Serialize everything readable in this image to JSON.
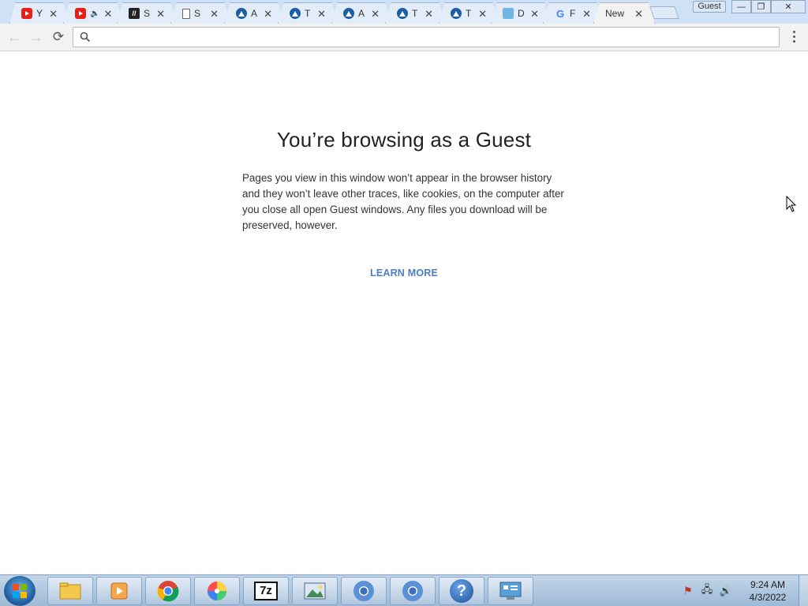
{
  "browser": {
    "tabs": [
      {
        "label": "Y",
        "favicon": "youtube-icon",
        "active": false
      },
      {
        "label": "",
        "favicon": "youtube-icon",
        "audio": "speaker-icon",
        "active": false
      },
      {
        "label": "S",
        "favicon": "dark-app-icon",
        "active": false
      },
      {
        "label": "S",
        "favicon": "document-icon",
        "active": false
      },
      {
        "label": "A",
        "favicon": "blue-triangle-icon",
        "active": false
      },
      {
        "label": "T",
        "favicon": "blue-triangle-icon",
        "active": false
      },
      {
        "label": "A",
        "favicon": "blue-triangle-icon",
        "active": false
      },
      {
        "label": "T",
        "favicon": "blue-triangle-icon",
        "active": false
      },
      {
        "label": "T",
        "favicon": "blue-triangle-icon",
        "active": false
      },
      {
        "label": "D",
        "favicon": "map-icon",
        "active": false
      },
      {
        "label": "F",
        "favicon": "google-icon",
        "active": false
      },
      {
        "label": "New",
        "favicon": "",
        "active": true
      }
    ],
    "tab_close_glyph": "✕",
    "profile_badge": "Guest",
    "window_controls": {
      "minimize": "—",
      "restore": "❐",
      "close": "✕"
    },
    "omnibox": {
      "value": "",
      "placeholder": ""
    }
  },
  "page": {
    "heading": "You’re browsing as a Guest",
    "body": "Pages you view in this window won’t appear in the browser history and they won’t leave other traces, like cookies, on the computer after you close all open Guest windows. Any files you download will be preserved, however.",
    "learn_more": "LEARN MORE"
  },
  "taskbar": {
    "pinned": [
      "file-explorer-icon",
      "media-player-icon",
      "chrome-icon",
      "pinwheel-icon",
      "7zip-icon",
      "image-viewer-icon",
      "chromium-icon",
      "chromium-icon",
      "help-icon",
      "control-panel-icon"
    ],
    "sevenzip_label": "7z",
    "help_glyph": "?",
    "clock_time": "9:24 AM",
    "clock_date": "4/3/2022"
  },
  "colors": {
    "accent_link": "#4e7ec2",
    "tabstrip": "#cfe1f7",
    "taskbar": "#b0c8e2"
  }
}
